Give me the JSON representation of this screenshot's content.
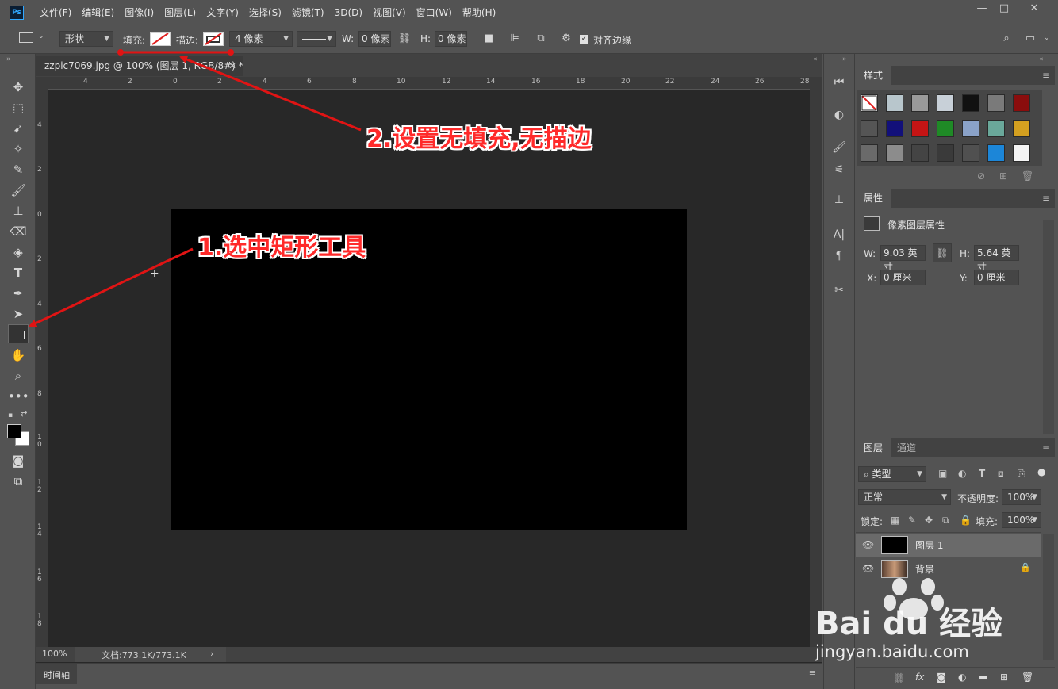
{
  "app": {
    "logo": "Ps"
  },
  "menu": [
    "文件(F)",
    "编辑(E)",
    "图像(I)",
    "图层(L)",
    "文字(Y)",
    "选择(S)",
    "滤镜(T)",
    "3D(D)",
    "视图(V)",
    "窗口(W)",
    "帮助(H)"
  ],
  "window_controls": {
    "minimize": "—",
    "maximize": "□",
    "close": "✕"
  },
  "options": {
    "mode": "形状",
    "fill_label": "填充:",
    "stroke_label": "描边:",
    "stroke_width": "4 像素",
    "w_label": "W:",
    "w_value": "0 像素",
    "h_label": "H:",
    "h_value": "0 像素",
    "align_edges": "对齐边缘"
  },
  "document": {
    "tab": "zzpic7069.jpg @ 100% (图层 1, RGB/8#) *",
    "zoom": "100%",
    "doc_info": "文档:773.1K/773.1K",
    "ruler_top": [
      "4",
      "2",
      "0",
      "2",
      "4",
      "6",
      "8",
      "10",
      "12",
      "14",
      "16",
      "18",
      "20",
      "22",
      "24",
      "26",
      "28"
    ],
    "ruler_left": [
      "4",
      "2",
      "0",
      "2",
      "4",
      "6",
      "8",
      "1 0",
      "1 2",
      "1 4",
      "1 6",
      "1 8"
    ],
    "timeline": "时间轴"
  },
  "panels": {
    "styles": {
      "tab": "样式"
    },
    "properties": {
      "tab": "属性",
      "title": "像素图层属性",
      "w_label": "W:",
      "w_value": "9.03 英寸",
      "h_label": "H:",
      "h_value": "5.64 英寸",
      "x_label": "X:",
      "x_value": "0 厘米",
      "y_label": "Y:",
      "y_value": "0 厘米"
    },
    "layers": {
      "tabs": [
        "图层",
        "通道"
      ],
      "filter": "类型",
      "blend": "正常",
      "opacity_label": "不透明度:",
      "opacity": "100%",
      "lock_label": "锁定:",
      "fill_label": "填充:",
      "fill": "100%",
      "items": [
        {
          "name": "图层 1"
        },
        {
          "name": "背景"
        }
      ]
    }
  },
  "annotations": {
    "step1": "1.选中矩形工具",
    "step2": "2.设置无填充,无描边"
  },
  "watermark": {
    "brand": "Bai du 经验",
    "url": "jingyan.baidu.com"
  }
}
